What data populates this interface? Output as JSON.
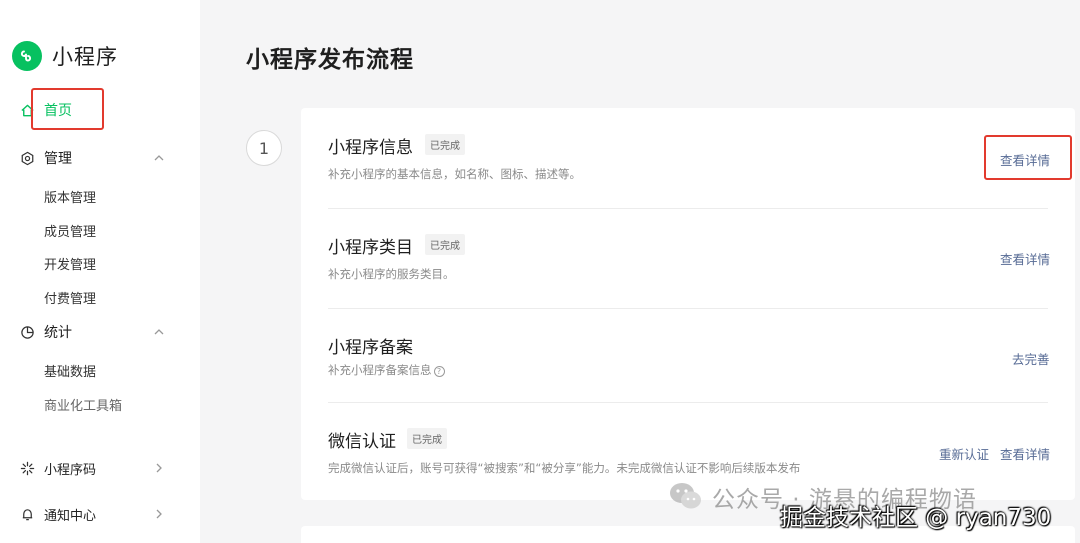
{
  "app": {
    "name": "小程序",
    "page_title": "小程序发布流程"
  },
  "sidebar": {
    "home": "首页",
    "manage": {
      "label": "管理",
      "items": [
        "版本管理",
        "成员管理",
        "开发管理",
        "付费管理"
      ]
    },
    "stats": {
      "label": "统计",
      "items": [
        "基础数据",
        "商业化工具箱"
      ]
    },
    "qrcode": "小程序码",
    "notify": "通知中心"
  },
  "step": {
    "number": "1"
  },
  "sections": [
    {
      "title": "小程序信息",
      "badge": "已完成",
      "desc": "补充小程序的基本信息，如名称、图标、描述等。",
      "link": "查看详情"
    },
    {
      "title": "小程序类目",
      "badge": "已完成",
      "desc": "补充小程序的服务类目。",
      "link": "查看详情"
    },
    {
      "title": "小程序备案",
      "desc": "补充小程序备案信息",
      "link": "去完善"
    },
    {
      "title": "微信认证",
      "badge": "已完成",
      "desc": "完成微信认证后，账号可获得“被搜索”和“被分享”能力。未完成微信认证不影响后续版本发布",
      "link_secondary": "重新认证",
      "link": "查看详情"
    }
  ],
  "watermark": {
    "line1": "公众号 · 游悬的编程物语",
    "line2": "掘金技术社区 @ ryan730"
  },
  "colors": {
    "brand": "#07c160",
    "link": "#576b95",
    "annotation": "#e23a2e"
  }
}
